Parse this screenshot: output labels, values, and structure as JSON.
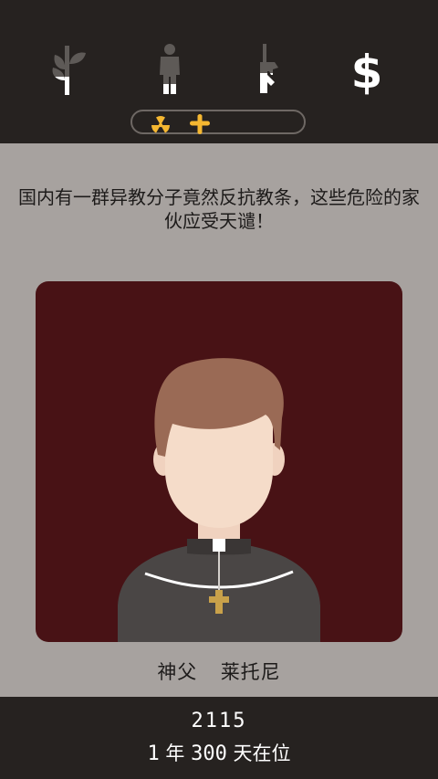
{
  "stats": {
    "church": {
      "icon": "church-cross-icon",
      "fill_level": 0.35
    },
    "people": {
      "icon": "person-icon",
      "fill_level": 0.22
    },
    "army": {
      "icon": "rifle-icon",
      "fill_level": 0.4
    },
    "money": {
      "icon": "dollar-icon",
      "fill_level": 1.0
    }
  },
  "badges": [
    {
      "icon": "radiation-icon",
      "color": "#f5b731"
    },
    {
      "icon": "cross-icon",
      "color": "#f5b731"
    }
  ],
  "message": "国内有一群异教分子竟然反抗教条，这些危险的家伙应受天谴！",
  "character": {
    "title": "神父",
    "name": "莱托尼"
  },
  "footer": {
    "year": "2115",
    "reign_years": "1",
    "years_unit": "年",
    "reign_days": "300",
    "days_unit": "天在位"
  },
  "colors": {
    "bar_bg": "#262220",
    "page_bg": "#a7a29f",
    "portrait_bg": "#481215",
    "accent": "#f5b731"
  }
}
